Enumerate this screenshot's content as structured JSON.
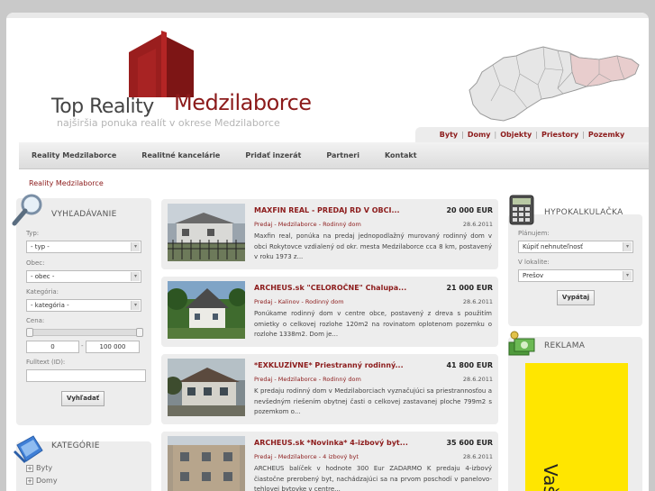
{
  "header": {
    "logo_top": "Top Reality",
    "logo_brand": "Medzilaborce",
    "logo_sub": "najširšia ponuka realít v okrese Medzilaborce"
  },
  "category_tabs": [
    "Byty",
    "Domy",
    "Objekty",
    "Priestory",
    "Pozemky"
  ],
  "nav": [
    "Reality Medzilaborce",
    "Realitné kancelárie",
    "Pridať inzerát",
    "Partneri",
    "Kontakt"
  ],
  "breadcrumb": "Reality Medzilaborce",
  "search": {
    "title": "VYHĽADÁVANIE",
    "typ_label": "Typ:",
    "typ_value": "- typ -",
    "obec_label": "Obec:",
    "obec_value": "- obec -",
    "kategoria_label": "Kategória:",
    "kategoria_value": "- kategória -",
    "cena_label": "Cena:",
    "price_min": "0",
    "price_max": "100 000",
    "price_sep": "-",
    "fulltext_label": "Fulltext (ID):",
    "button": "Vyhľadať"
  },
  "categories": {
    "title": "KATEGÓRIE",
    "items": [
      "Byty",
      "Domy"
    ]
  },
  "listings": [
    {
      "title": "MAXFIN REAL - PREDAJ RD V OBCI...",
      "price": "20 000 EUR",
      "meta": "Predaj - Medzilaborce - Rodinný dom",
      "date": "28.6.2011",
      "desc": "Maxfin real, ponúka na predaj jednopodlažný murovaný rodinný dom v obci Rokytovce vzdialený od okr. mesta Medzilaborce cca 8 km, postavený v roku 1973 z..."
    },
    {
      "title": "ARCHEUS.sk \"CELOROČNE\" Chalupa...",
      "price": "21 000 EUR",
      "meta": "Predaj - Kalinov - Rodinný dom",
      "date": "28.6.2011",
      "desc": "Ponúkame rodinný dom v centre obce, postavený z dreva s použitím omietky o celkovej rozlohe 120m2 na rovinatom oplotenom pozemku o rozlohe 1338m2. Dom je..."
    },
    {
      "title": "*EXKLUZÍVNE* Priestranný rodinný...",
      "price": "41 800 EUR",
      "meta": "Predaj - Medzilaborce - Rodinný dom",
      "date": "28.6.2011",
      "desc": "K predaju rodinný dom v Medzilaborciach vyznačujúci sa priestrannosťou a nevšedným riešením obytnej časti o celkovej zastavanej ploche 799m2 s pozemkom o..."
    },
    {
      "title": "ARCHEUS.sk *Novinka* 4-izbový byt...",
      "price": "35 600 EUR",
      "meta": "Predaj - Medzilaborce - 4 izbový byt",
      "date": "28.6.2011",
      "desc": "ARCHEUS balíček v hodnote 300 Eur ZADARMO K predaju 4-izbový čiastočne prerobený byt, nachádzajúci sa na prvom poschodí v panelovo-tehlovej bytovke v centre..."
    }
  ],
  "hypo": {
    "title": "HYPOKALKULAČKA",
    "planujem_label": "Plánujem:",
    "planujem_value": "Kúpiť nehnuteľnosť",
    "lokalita_label": "V lokalite:",
    "lokalita_value": "Prešov",
    "button": "Vypátaj"
  },
  "reklama": {
    "title": "REKLAMA",
    "ad_text": "Vaš"
  },
  "colors": {
    "brand": "#8c1b1b",
    "panel": "#ededed",
    "ad": "#ffe600"
  }
}
